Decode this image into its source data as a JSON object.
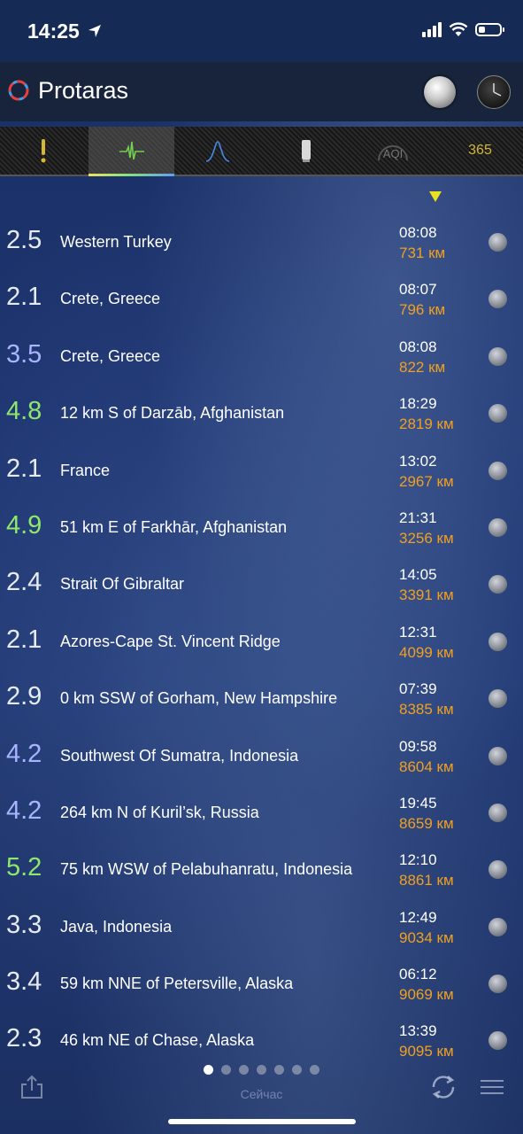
{
  "status_bar": {
    "time": "14:25"
  },
  "header": {
    "title": "Protaras"
  },
  "tabs": [
    {
      "icon": "exclamation-icon",
      "active": false
    },
    {
      "icon": "seismograph-icon",
      "active": true
    },
    {
      "icon": "wave-peak-icon",
      "active": false
    },
    {
      "icon": "cylinder-icon",
      "active": false
    },
    {
      "icon": "aqi-icon",
      "label": "AQI",
      "active": false
    },
    {
      "label": "365",
      "active": false
    }
  ],
  "colors": {
    "mag_default": "#e6ebf2",
    "mag_green": "#8ee86e",
    "mag_blue": "#a9b4ff",
    "distance": "#f0a020"
  },
  "quakes": [
    {
      "mag": "2.5",
      "place": "Western Turkey",
      "time": "08:08",
      "distance": "731 км",
      "level": "default"
    },
    {
      "mag": "2.1",
      "place": "Crete, Greece",
      "time": "08:07",
      "distance": "796 км",
      "level": "default"
    },
    {
      "mag": "3.5",
      "place": "Crete, Greece",
      "time": "08:08",
      "distance": "822 км",
      "level": "blue"
    },
    {
      "mag": "4.8",
      "place": "12 km S of Darzāb, Afghanistan",
      "time": "18:29",
      "distance": "2819 км",
      "level": "green"
    },
    {
      "mag": "2.1",
      "place": "France",
      "time": "13:02",
      "distance": "2967 км",
      "level": "default"
    },
    {
      "mag": "4.9",
      "place": "51 km E of Farkhār, Afghanistan",
      "time": "21:31",
      "distance": "3256 км",
      "level": "green"
    },
    {
      "mag": "2.4",
      "place": "Strait Of Gibraltar",
      "time": "14:05",
      "distance": "3391 км",
      "level": "default"
    },
    {
      "mag": "2.1",
      "place": "Azores-Cape St. Vincent Ridge",
      "time": "12:31",
      "distance": "4099 км",
      "level": "default"
    },
    {
      "mag": "2.9",
      "place": "0 km SSW of Gorham, New Hampshire",
      "time": "07:39",
      "distance": "8385 км",
      "level": "default"
    },
    {
      "mag": "4.2",
      "place": "Southwest Of Sumatra, Indonesia",
      "time": "09:58",
      "distance": "8604 км",
      "level": "blue"
    },
    {
      "mag": "4.2",
      "place": "264 km N of Kuril’sk, Russia",
      "time": "19:45",
      "distance": "8659 км",
      "level": "blue"
    },
    {
      "mag": "5.2",
      "place": "75 km WSW of Pelabuhanratu, Indonesia",
      "time": "12:10",
      "distance": "8861 км",
      "level": "green"
    },
    {
      "mag": "3.3",
      "place": "Java, Indonesia",
      "time": "12:49",
      "distance": "9034 км",
      "level": "default"
    },
    {
      "mag": "3.4",
      "place": "59 km NNE of Petersville, Alaska",
      "time": "06:12",
      "distance": "9069 км",
      "level": "default"
    },
    {
      "mag": "2.3",
      "place": "46 km NE of Chase, Alaska",
      "time": "13:39",
      "distance": "9095 км",
      "level": "default"
    }
  ],
  "footer": {
    "now_label": "Сейчас",
    "pages_total": 7,
    "page_active": 1
  }
}
